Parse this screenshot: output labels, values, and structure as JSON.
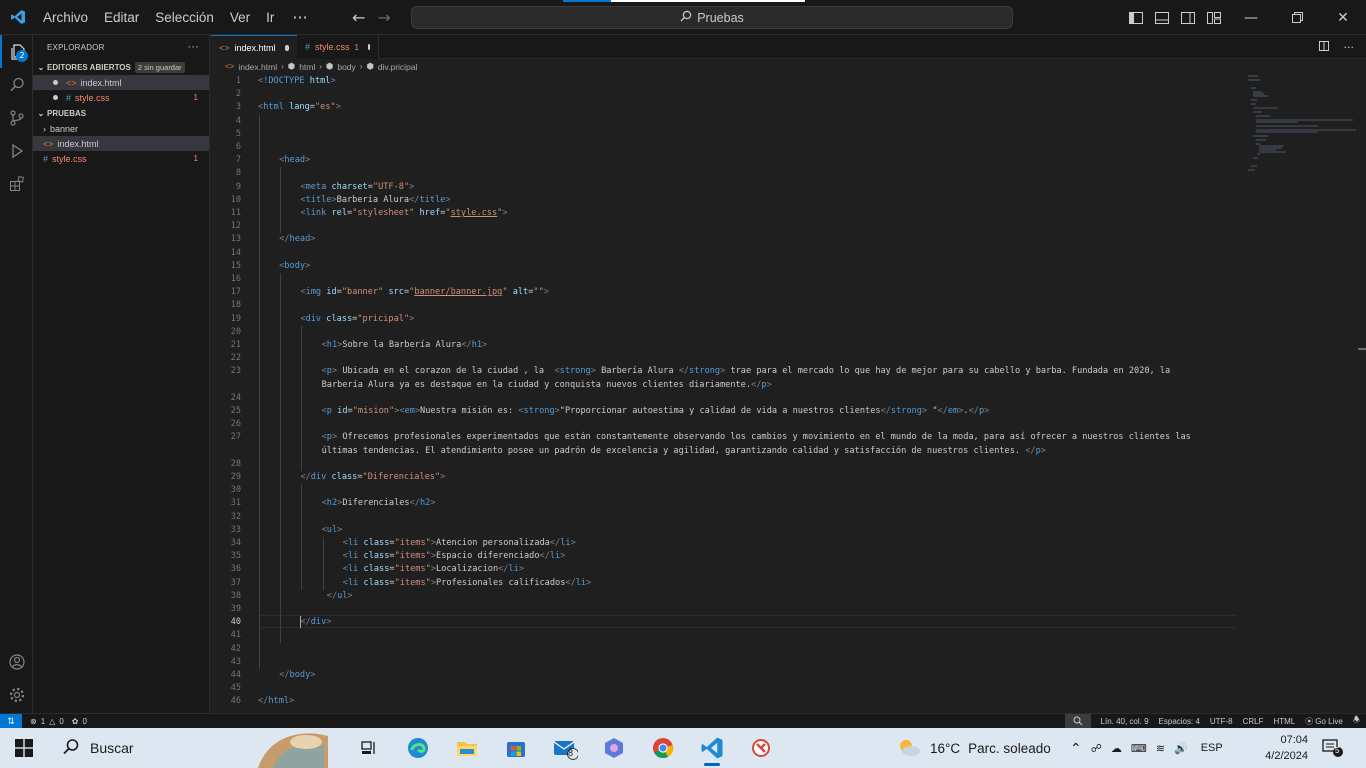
{
  "titlebar": {
    "menu": [
      "Archivo",
      "Editar",
      "Selección",
      "Ver",
      "Ir"
    ],
    "more": "···",
    "search": "Pruebas"
  },
  "activity": {
    "explorer_badge": "2"
  },
  "sidebar": {
    "title": "EXPLORADOR",
    "more": "···",
    "open_editors_label": "EDITORES ABIERTOS",
    "unsaved_tag": "2 sin guardar",
    "open_editors": [
      {
        "name": "index.html",
        "type": "html",
        "count": ""
      },
      {
        "name": "style.css",
        "type": "css",
        "count": "1"
      }
    ],
    "folder_label": "PRUEBAS",
    "tree": [
      {
        "name": "banner",
        "type": "folder",
        "count": ""
      },
      {
        "name": "index.html",
        "type": "html",
        "count": ""
      },
      {
        "name": "style.css",
        "type": "css",
        "count": "1"
      }
    ]
  },
  "tabs": [
    {
      "label": "index.html",
      "count": "",
      "active": true
    },
    {
      "label": "style.css",
      "count": "1",
      "active": false
    }
  ],
  "breadcrumb": [
    "index.html",
    "html",
    "body",
    "div.pricipal"
  ],
  "editor": {
    "current_line": 40,
    "lines": [
      {
        "n": "1",
        "indent": 0,
        "code": "<!DOCTYPE html>"
      },
      {
        "n": "2",
        "indent": 0,
        "code": ""
      },
      {
        "n": "3",
        "indent": 0,
        "code": "<html lang=\"es\">"
      },
      {
        "n": "4",
        "indent": 0,
        "code": ""
      },
      {
        "n": "5",
        "indent": 0,
        "code": ""
      },
      {
        "n": "6",
        "indent": 0,
        "code": ""
      },
      {
        "n": "7",
        "indent": 1,
        "code": "<head>"
      },
      {
        "n": "8",
        "indent": 0,
        "code": ""
      },
      {
        "n": "9",
        "indent": 2,
        "code": "<meta charset=\"UTF-8\">"
      },
      {
        "n": "10",
        "indent": 2,
        "code": "<title>Barberia Alura</title>"
      },
      {
        "n": "11",
        "indent": 2,
        "code": "<link rel=\"stylesheet\" href=\"style.css\">"
      },
      {
        "n": "12",
        "indent": 0,
        "code": ""
      },
      {
        "n": "13",
        "indent": 1,
        "code": "</head>"
      },
      {
        "n": "14",
        "indent": 0,
        "code": ""
      },
      {
        "n": "15",
        "indent": 1,
        "code": "<body>"
      },
      {
        "n": "16",
        "indent": 0,
        "code": ""
      },
      {
        "n": "17",
        "indent": 2,
        "code": "<img id=\"banner\" src=\"banner/banner.jpg\" alt=\"\">"
      },
      {
        "n": "18",
        "indent": 0,
        "code": ""
      },
      {
        "n": "19",
        "indent": 2,
        "code": "<div class=\"pricipal\">"
      },
      {
        "n": "20",
        "indent": 0,
        "code": ""
      },
      {
        "n": "21",
        "indent": 3,
        "code": "<h1>Sobre la Barbería Alura</h1>"
      },
      {
        "n": "22",
        "indent": 0,
        "code": ""
      },
      {
        "n": "23",
        "indent": 3,
        "code": "<p> Ubicada en el corazon de la ciudad , la  <strong> Barbería Alura </strong> trae para el mercado lo que hay de mejor para su cabello y barba. Fundada en 2020, la"
      },
      {
        "n": "",
        "indent": 3,
        "code": "Barbería Alura ya es destaque en la ciudad y conquista nuevos clientes diariamente.</p>"
      },
      {
        "n": "24",
        "indent": 0,
        "code": ""
      },
      {
        "n": "25",
        "indent": 3,
        "code": "<p id=\"mision\"><em>Nuestra misión es: <strong>\"Proporcionar autoestima y calidad de vida a nuestros clientes</strong> \"</em>.</p>"
      },
      {
        "n": "26",
        "indent": 0,
        "code": ""
      },
      {
        "n": "27",
        "indent": 3,
        "code": "<p> Ofrecemos profesionales experimentados que están constantemente observando los cambios y movimiento en el mundo de la moda, para así ofrecer a nuestros clientes las"
      },
      {
        "n": "",
        "indent": 3,
        "code": "últimas tendencias. El atendimiento posee un padrón de excelencia y agilidad, garantizando calidad y satisfacción de nuestros clientes. </p>"
      },
      {
        "n": "28",
        "indent": 0,
        "code": ""
      },
      {
        "n": "29",
        "indent": 2,
        "code": "</div class=\"Diferenciales\">"
      },
      {
        "n": "30",
        "indent": 0,
        "code": ""
      },
      {
        "n": "31",
        "indent": 3,
        "code": "<h2>Diferenciales</h2>"
      },
      {
        "n": "32",
        "indent": 0,
        "code": ""
      },
      {
        "n": "33",
        "indent": 3,
        "code": "<ul>"
      },
      {
        "n": "34",
        "indent": 4,
        "code": "<li class=\"items\">Atencion personalizada</li>"
      },
      {
        "n": "35",
        "indent": 4,
        "code": "<li class=\"items\">Espacio diferenciado</li>"
      },
      {
        "n": "36",
        "indent": 4,
        "code": "<li class=\"items\">Localizacion</li>"
      },
      {
        "n": "37",
        "indent": 4,
        "code": "<li class=\"items\">Profesionales calificados</li>"
      },
      {
        "n": "38",
        "indent": 3,
        "code": " </ul>"
      },
      {
        "n": "39",
        "indent": 0,
        "code": ""
      },
      {
        "n": "40",
        "indent": 2,
        "code": "</div>"
      },
      {
        "n": "41",
        "indent": 0,
        "code": ""
      },
      {
        "n": "42",
        "indent": 0,
        "code": ""
      },
      {
        "n": "43",
        "indent": 0,
        "code": ""
      },
      {
        "n": "44",
        "indent": 1,
        "code": "</body>"
      },
      {
        "n": "45",
        "indent": 0,
        "code": ""
      },
      {
        "n": "46",
        "indent": 0,
        "code": "</html>"
      }
    ]
  },
  "statusbar": {
    "errors": "1",
    "warnings": "0",
    "ports": "0",
    "position": "Lín. 40, col. 9",
    "spaces": "Espacios: 4",
    "encoding": "UTF-8",
    "eol": "CRLF",
    "language": "HTML",
    "golive": "Go Live"
  },
  "taskbar": {
    "search": "Buscar",
    "mail_badge": "8",
    "weather_temp": "16°C",
    "weather_text": "Parc. soleado",
    "lang": "ESP",
    "time": "07:04",
    "date": "4/2/2024",
    "notif_count": "5"
  },
  "colors": {
    "accent": "#0078d4",
    "tag": "#569cd6",
    "attr": "#9cdcfe",
    "string": "#ce9178",
    "error": "#f48771"
  }
}
